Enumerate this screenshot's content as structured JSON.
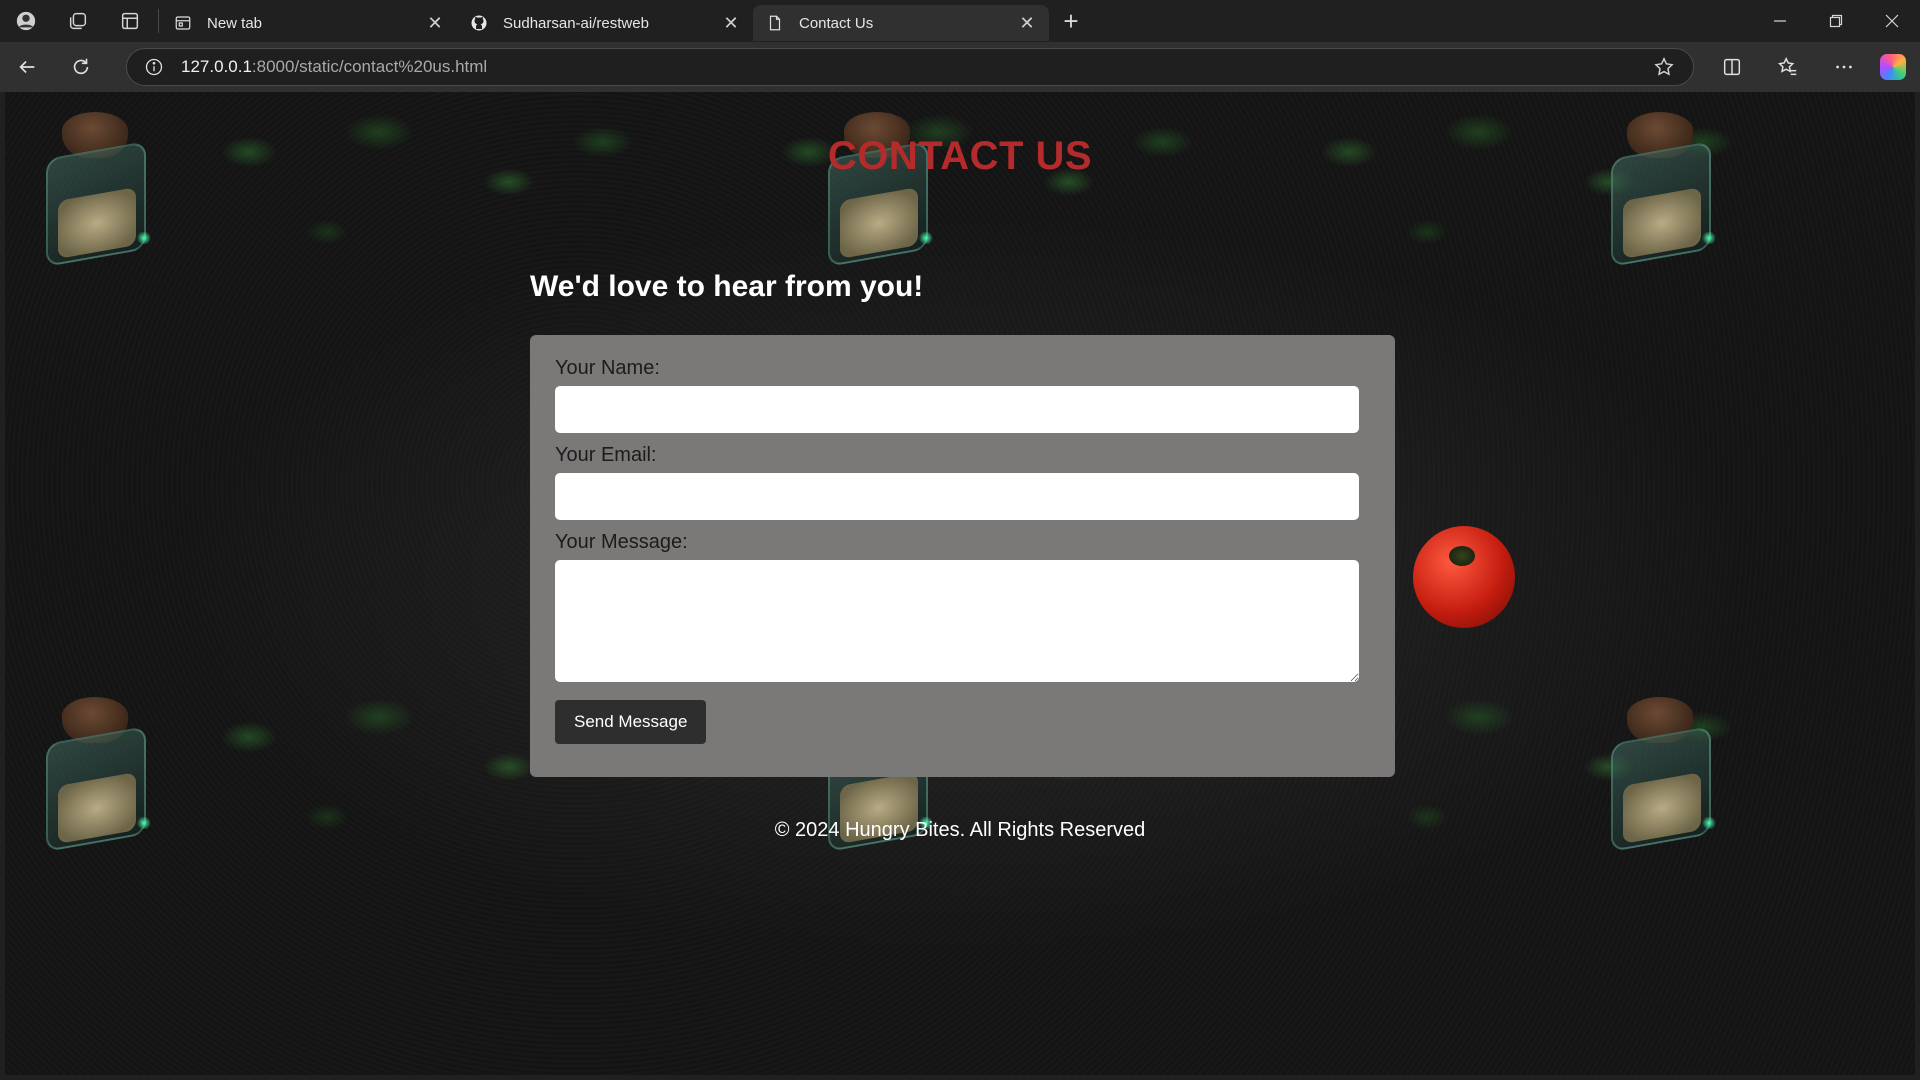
{
  "browser": {
    "tabs": [
      {
        "title": "New tab",
        "icon": "newtab-page-icon",
        "active": false
      },
      {
        "title": "Sudharsan-ai/restweb",
        "icon": "github-icon",
        "active": false
      },
      {
        "title": "Contact Us",
        "icon": "document-icon",
        "active": true
      }
    ],
    "address": {
      "host": "127.0.0.1",
      "path": ":8000/static/contact%20us.html"
    }
  },
  "page": {
    "heading": "CONTACT US",
    "subheading": "We'd love to hear from you!",
    "form": {
      "name_label": "Your Name:",
      "name_value": "",
      "email_label": "Your Email:",
      "email_value": "",
      "message_label": "Your Message:",
      "message_value": "",
      "submit_label": "Send Message"
    },
    "footer": "© 2024 Hungry Bites. All Rights Reserved"
  },
  "colors": {
    "heading": "#b52a2a",
    "form_background": "#7b7878",
    "button_background": "#2e2e2e"
  }
}
